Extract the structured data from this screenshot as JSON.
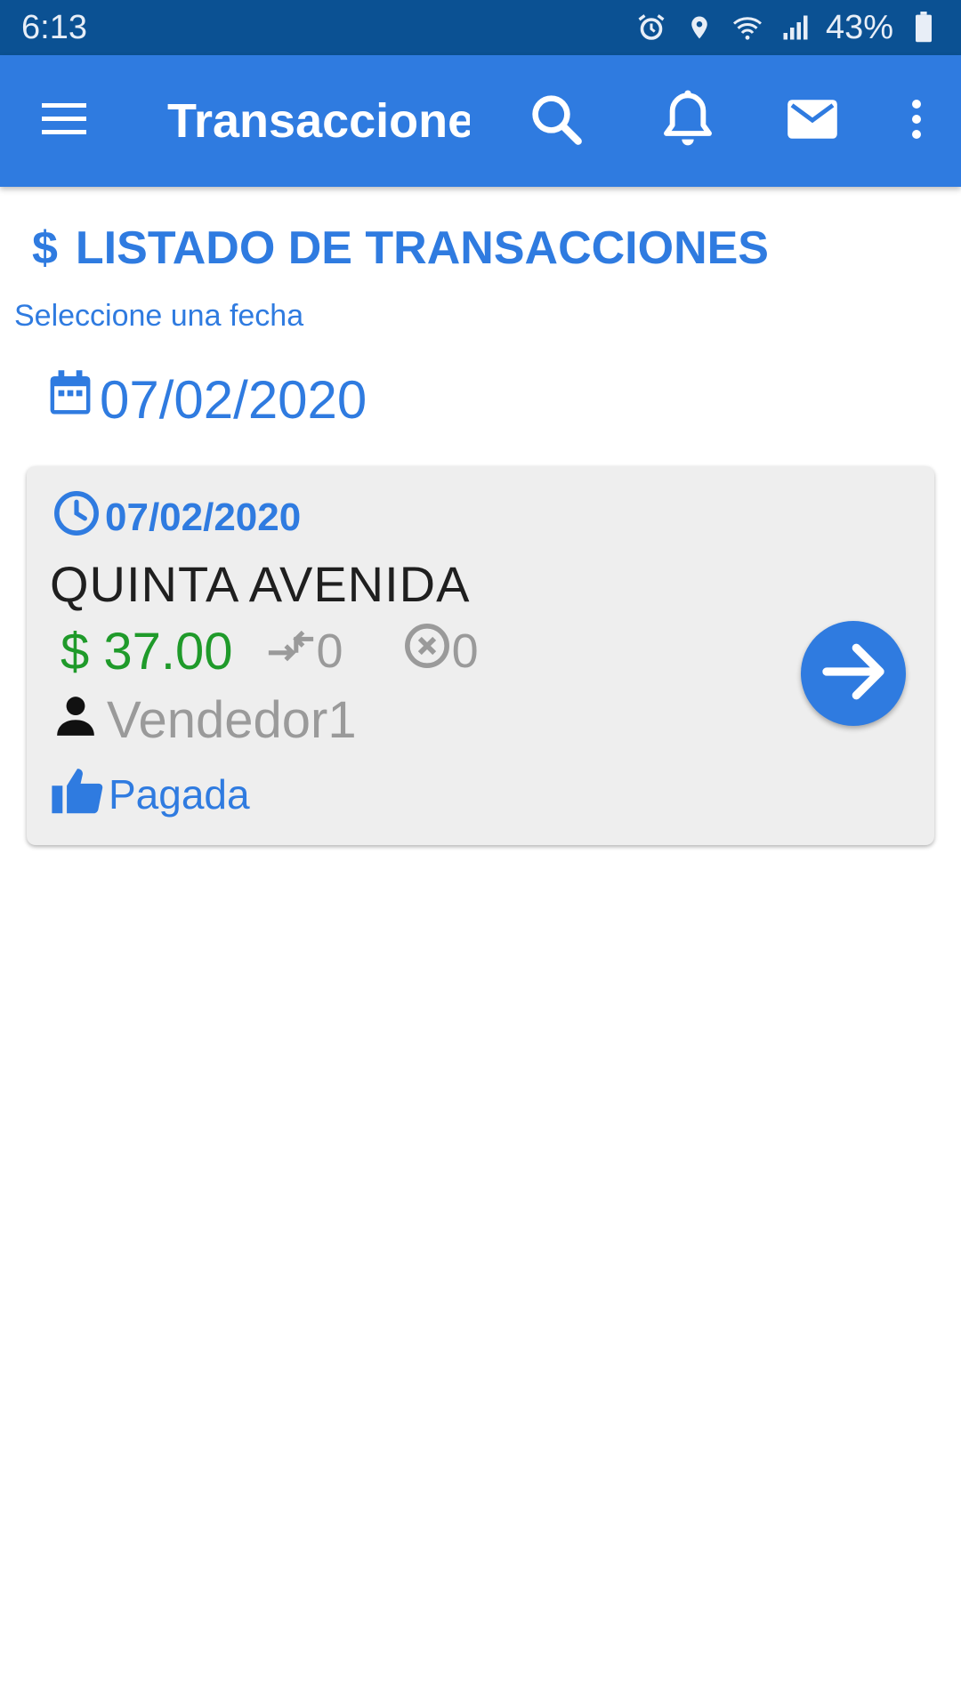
{
  "status_bar": {
    "time": "6:13",
    "battery": "43%",
    "icons": [
      "alarm-icon",
      "location-icon",
      "wifi-icon",
      "signal-icon",
      "battery-icon"
    ]
  },
  "app_bar": {
    "title": "Transacciones",
    "color": "#2f7be0",
    "icons": [
      "menu-icon",
      "search-icon",
      "bell-icon",
      "mail-icon",
      "more-vert-icon"
    ]
  },
  "page": {
    "heading_symbol": "$",
    "heading": "LISTADO DE TRANSACCIONES",
    "select_label": "Seleccione una fecha",
    "selected_date": "07/02/2020"
  },
  "transactions": [
    {
      "date": "07/02/2020",
      "store": "QUINTA AVENIDA",
      "amount": "$ 37.00",
      "returns": "0",
      "cancelled": "0",
      "seller": "Vendedor1",
      "status": "Pagada",
      "amount_color": "#1f9a2a"
    }
  ]
}
